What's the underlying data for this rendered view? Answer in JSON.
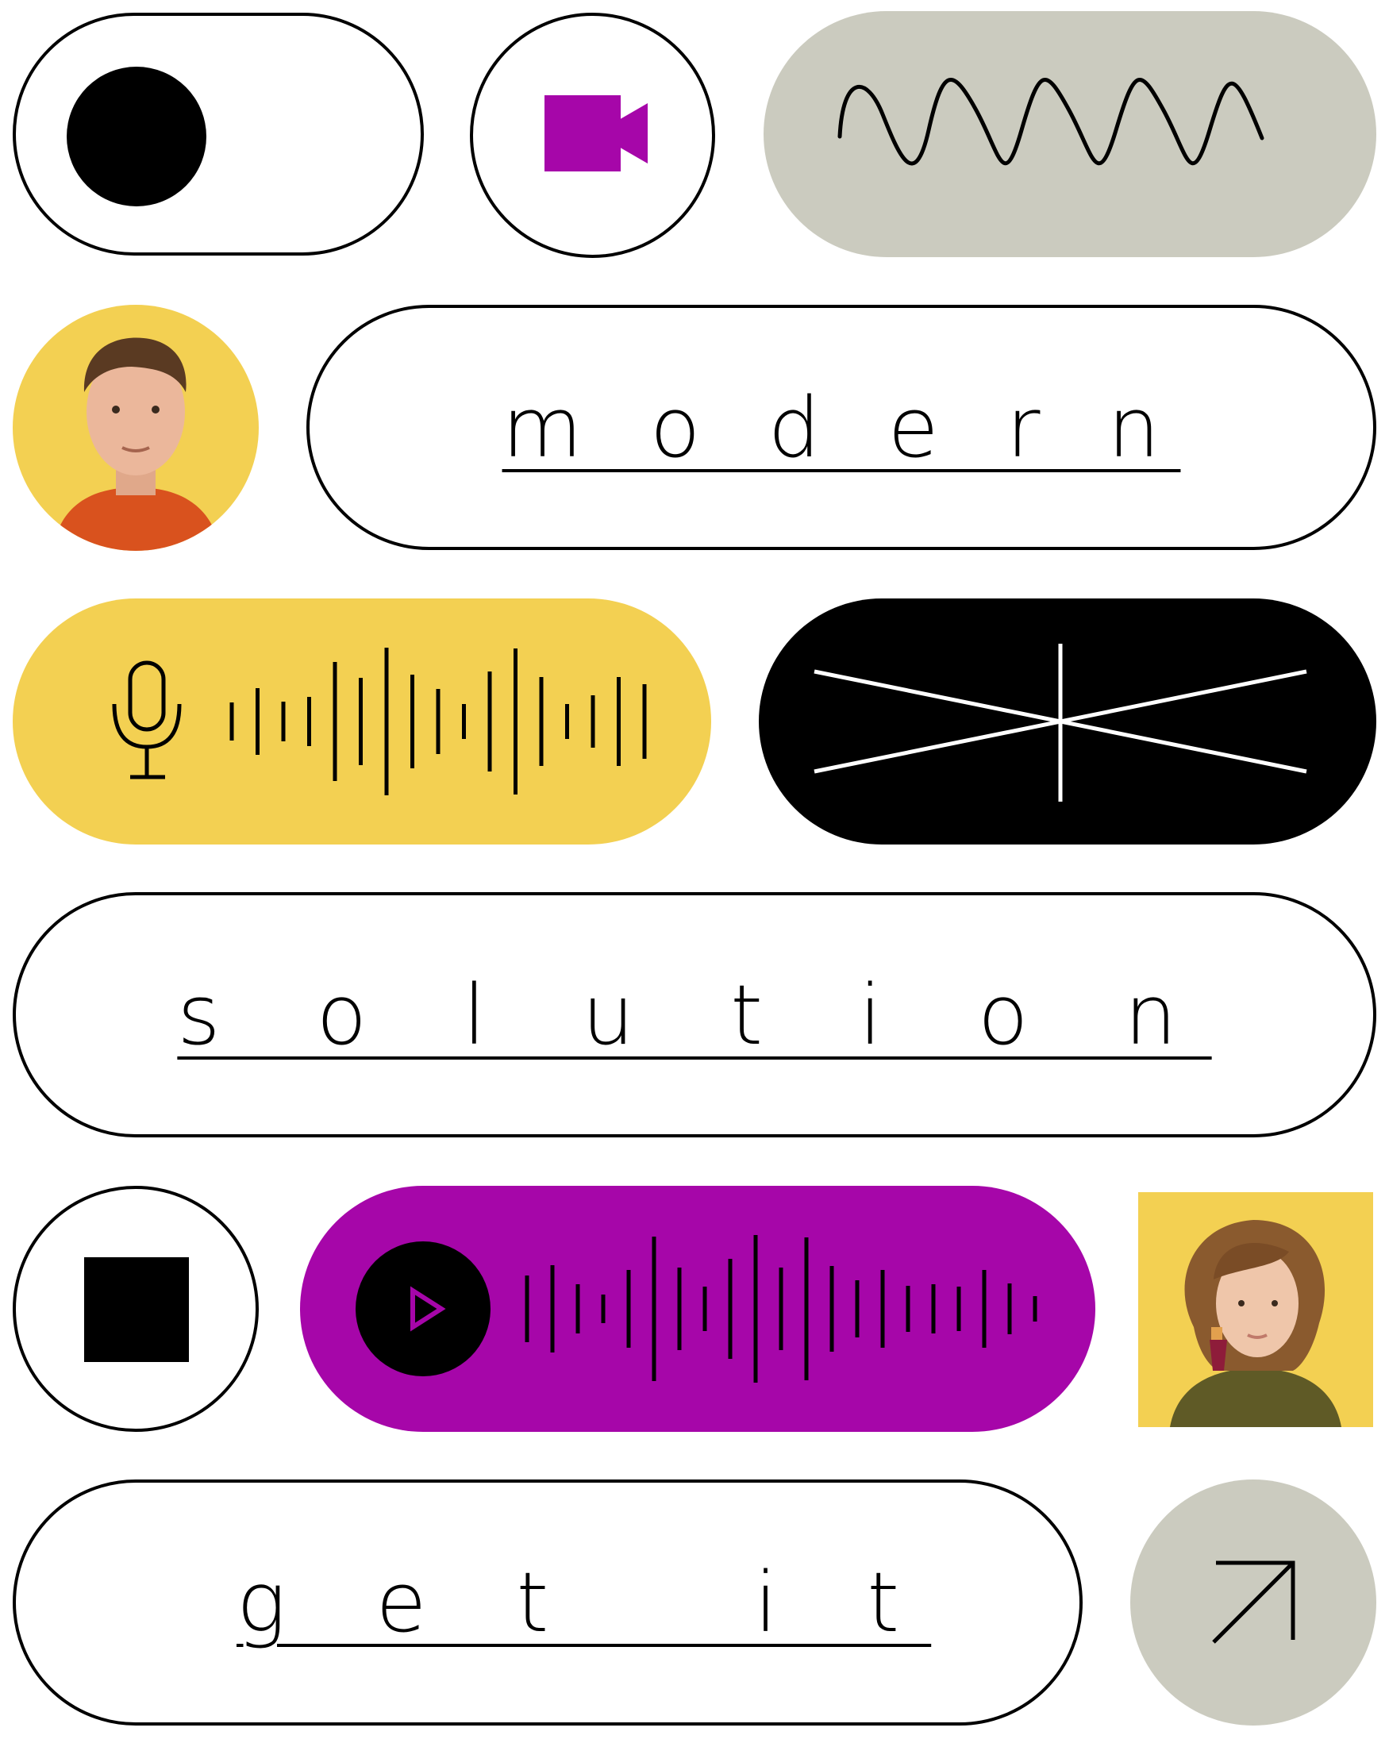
{
  "colors": {
    "yellow": "#F3D052",
    "purple": "#A606A9",
    "stone": "#CBCBBF",
    "black": "#000000",
    "white": "#FFFFFF"
  },
  "controls": {
    "toggle": {
      "state": "off",
      "icon": "toggle-knob"
    },
    "video_button": {
      "icon": "video-camera-icon"
    },
    "wave_pill": {
      "icon": "squiggle-wave-icon"
    },
    "voice_pill": {
      "icon": "microphone-icon"
    },
    "close_pill": {
      "icon": "cross-lines-icon"
    },
    "stop_button": {
      "icon": "stop-square-icon"
    },
    "player_pill": {
      "icon": "play-icon"
    },
    "arrow_button": {
      "icon": "arrow-up-right-icon"
    }
  },
  "words": {
    "modern": "m o d e r n",
    "solution": "s o l u t i o n",
    "get_it": "g e t   i t"
  },
  "avatars": {
    "man": {
      "icon": "avatar-man"
    },
    "woman": {
      "icon": "avatar-woman"
    }
  }
}
